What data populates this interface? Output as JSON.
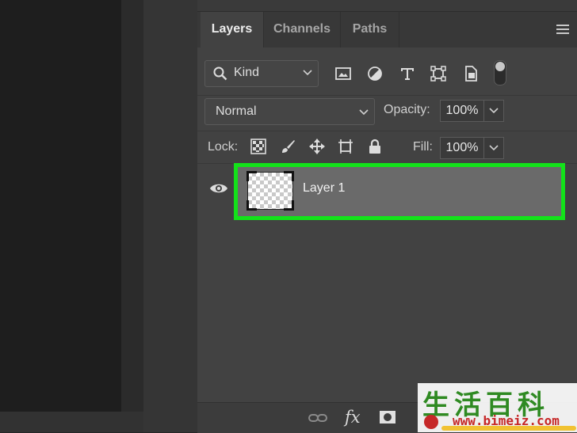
{
  "panel": {
    "tabs": [
      {
        "label": "Layers",
        "active": true
      },
      {
        "label": "Channels",
        "active": false
      },
      {
        "label": "Paths",
        "active": false
      }
    ],
    "menu_icon": "panel-menu-icon"
  },
  "filter": {
    "kind_label": "Kind",
    "icons": [
      "image-filter-icon",
      "adjustment-filter-icon",
      "type-filter-icon",
      "shape-filter-icon",
      "smart-object-filter-icon"
    ]
  },
  "blend": {
    "mode": "Normal",
    "opacity_label": "Opacity:",
    "opacity_value": "100%"
  },
  "lock": {
    "label": "Lock:",
    "icons": [
      "lock-transparent-pixels-icon",
      "lock-image-pixels-icon",
      "lock-position-icon",
      "lock-artboard-icon",
      "lock-all-icon"
    ],
    "fill_label": "Fill:",
    "fill_value": "100%"
  },
  "layers": [
    {
      "name": "Layer 1",
      "visible": true,
      "selected": true
    }
  ],
  "footer_icons": [
    "link-layers-icon",
    "fx-icon",
    "layer-mask-icon"
  ],
  "watermark": {
    "chars": "生活百科",
    "url": "www.bimeiz.com"
  },
  "colors": {
    "highlight": "#13e21a",
    "panel_bg": "#424242",
    "selected_layer_bg": "#6a6a6a"
  }
}
